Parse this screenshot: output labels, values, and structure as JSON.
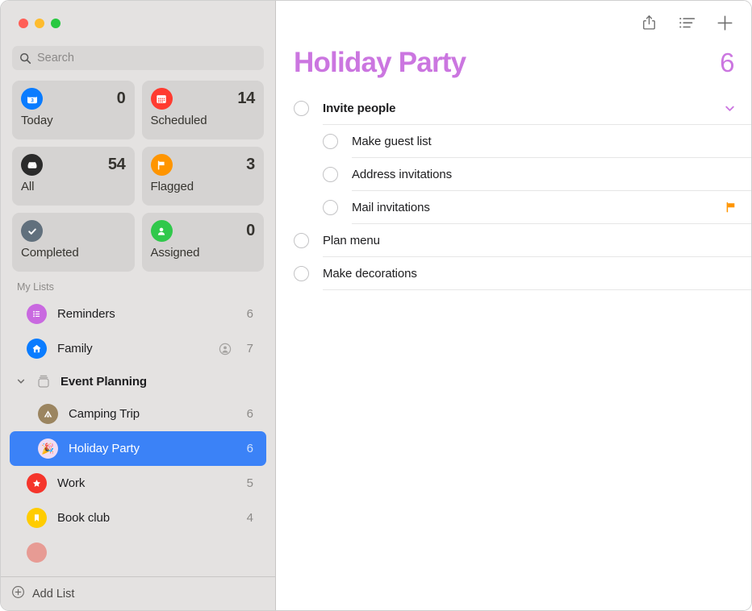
{
  "window": {
    "traffic_lights": [
      {
        "name": "close",
        "color": "#ff5f57"
      },
      {
        "name": "minimize",
        "color": "#febc2e"
      },
      {
        "name": "zoom",
        "color": "#28c840"
      }
    ]
  },
  "sidebar": {
    "search": {
      "value": "",
      "placeholder": "Search",
      "icon": "search-icon"
    },
    "smart_lists": [
      {
        "id": "today",
        "label": "Today",
        "count": "0",
        "icon": "calendar-day-icon",
        "color": "#0a7cff"
      },
      {
        "id": "scheduled",
        "label": "Scheduled",
        "count": "14",
        "icon": "calendar-icon",
        "color": "#ff3b30"
      },
      {
        "id": "all",
        "label": "All",
        "count": "54",
        "icon": "inbox-tray-icon",
        "color": "#2b2b2b"
      },
      {
        "id": "flagged",
        "label": "Flagged",
        "count": "3",
        "icon": "flag-icon",
        "color": "#ff9500"
      },
      {
        "id": "completed",
        "label": "Completed",
        "count": "",
        "icon": "checkmark-icon",
        "color": "#61707d"
      },
      {
        "id": "assigned",
        "label": "Assigned",
        "count": "0",
        "icon": "person-icon",
        "color": "#30c84b"
      }
    ],
    "my_lists_header": "My Lists",
    "lists": [
      {
        "id": "reminders",
        "label": "Reminders",
        "count": "6",
        "icon": "bulleted-list-icon",
        "color": "#c969e0",
        "indent": false,
        "selected": false,
        "shared": false
      },
      {
        "id": "family",
        "label": "Family",
        "count": "7",
        "icon": "house-icon",
        "color": "#0a7cff",
        "indent": false,
        "selected": false,
        "shared": true
      },
      {
        "id": "camping-trip",
        "label": "Camping Trip",
        "count": "6",
        "icon": "tent-icon",
        "color": "#9b8560",
        "indent": true,
        "selected": false,
        "shared": false
      },
      {
        "id": "holiday-party",
        "label": "Holiday Party",
        "count": "6",
        "icon": "party-popper-icon",
        "color": "#f0dcf2",
        "indent": true,
        "selected": true,
        "shared": false
      },
      {
        "id": "work",
        "label": "Work",
        "count": "5",
        "icon": "star-icon",
        "color": "#f5352b",
        "indent": false,
        "selected": false,
        "shared": false
      },
      {
        "id": "book-club",
        "label": "Book club",
        "count": "4",
        "icon": "bookmark-icon",
        "color": "#ffcc00",
        "indent": false,
        "selected": false,
        "shared": false
      }
    ],
    "group": {
      "id": "event-planning",
      "label": "Event Planning",
      "icon": "group-folder-icon",
      "chevron": "chevron-down-icon",
      "expanded": true
    },
    "partial_list": {
      "color": "#e79b94"
    },
    "add_list": {
      "label": "Add List",
      "icon": "plus-circle-icon"
    }
  },
  "main": {
    "toolbar": [
      {
        "id": "share",
        "name": "share-icon",
        "label": "Share"
      },
      {
        "id": "sort",
        "name": "list-options-icon",
        "label": "List Options"
      },
      {
        "id": "add",
        "name": "plus-icon",
        "label": "New Reminder"
      }
    ],
    "title": "Holiday Party",
    "title_count": "6",
    "accent_color": "#cb76e0",
    "flag_color": "#ff9500",
    "reminders": [
      {
        "id": "invite-people",
        "text": "Invite people",
        "sub": false,
        "bold": true,
        "flagged": false,
        "chevron": true
      },
      {
        "id": "make-guest-list",
        "text": "Make guest list",
        "sub": true,
        "bold": false,
        "flagged": false,
        "chevron": false
      },
      {
        "id": "address-invitations",
        "text": "Address invitations",
        "sub": true,
        "bold": false,
        "flagged": false,
        "chevron": false
      },
      {
        "id": "mail-invitations",
        "text": "Mail invitations",
        "sub": true,
        "bold": false,
        "flagged": true,
        "chevron": false
      },
      {
        "id": "plan-menu",
        "text": "Plan menu",
        "sub": false,
        "bold": false,
        "flagged": false,
        "chevron": false
      },
      {
        "id": "make-decorations",
        "text": "Make decorations",
        "sub": false,
        "bold": false,
        "flagged": false,
        "chevron": false
      }
    ]
  }
}
